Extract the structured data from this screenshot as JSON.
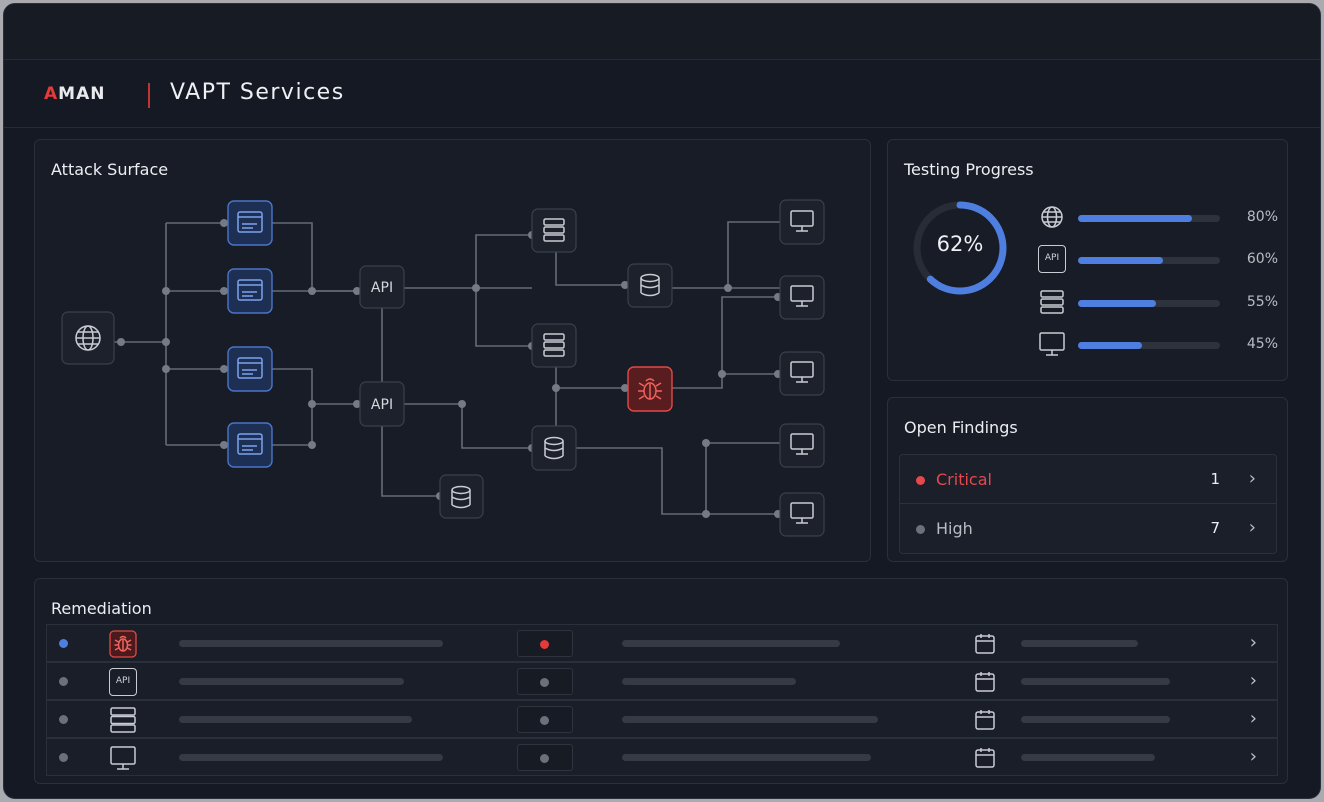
{
  "header": {
    "logo_mark": "A",
    "logo_rest": "MAN",
    "title": "VAPT Services"
  },
  "attack_surface": {
    "title": "Attack Surface",
    "api_label_1": "API",
    "api_label_2": "API"
  },
  "testing_progress": {
    "title": "Testing Progress",
    "overall": 62,
    "overall_label": "62%",
    "items": [
      {
        "icon": "globe-icon",
        "value": 80,
        "label": "80%"
      },
      {
        "icon": "api-icon",
        "value": 60,
        "label": "60%"
      },
      {
        "icon": "server-icon",
        "value": 55,
        "label": "55%"
      },
      {
        "icon": "monitor-icon",
        "value": 45,
        "label": "45%"
      }
    ],
    "api_icon_text": "API"
  },
  "open_findings": {
    "title": "Open Findings",
    "items": [
      {
        "label": "Critical",
        "count": "1",
        "color": "#e5484d"
      },
      {
        "label": "High",
        "count": "7",
        "color": "#6b707a"
      }
    ]
  },
  "remediation": {
    "title": "Remediation",
    "api_icon_text": "API",
    "rows": [
      {
        "icon": "bug-icon",
        "status_color": "#4e7fe0",
        "severity_color": "#e5393a"
      },
      {
        "icon": "api-icon",
        "status_color": "#6b707a",
        "severity_color": "#6b707a"
      },
      {
        "icon": "server-icon",
        "status_color": "#6b707a",
        "severity_color": "#6b707a"
      },
      {
        "icon": "monitor-icon",
        "status_color": "#6b707a",
        "severity_color": "#6b707a"
      }
    ]
  },
  "colors": {
    "accent": "#4e7fe0",
    "critical": "#e5393a",
    "background": "#141923"
  }
}
